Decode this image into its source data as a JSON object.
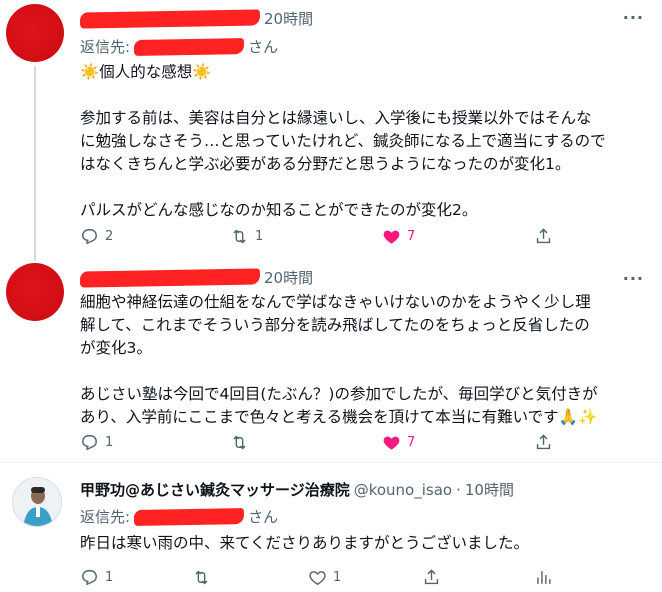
{
  "tweets": [
    {
      "time": "20時間",
      "reply_prefix": "返信先:",
      "reply_suffix": "さん",
      "lines": [
        "☀️個人的な感想☀️",
        "",
        "参加する前は、美容は自分とは縁遠いし、入学後にも授業以外ではそんな",
        "に勉強しなさそう…と思っていたけれど、鍼灸師になる上で適当にするので",
        "はなくきちんと学ぶ必要がある分野だと思うようになったのが変化1。",
        "",
        "パルスがどんな感じなのか知ることができたのが変化2。"
      ],
      "replies": "2",
      "retweets": "1",
      "likes": "7",
      "liked": true
    },
    {
      "time": "20時間",
      "lines": [
        "細胞や神経伝達の仕組をなんで学ばなきゃいけないのかをようやく少し理",
        "解して、これまでそういう部分を読み飛ばしてたのをちょっと反省したの",
        "が変化3。",
        "",
        "あじさい塾は今回で4回目(たぶん？)の参加でしたが、毎回学びと気付きが",
        "あり、入学前にここまで色々と考える機会を頂けて本当に有難いです🙏✨"
      ],
      "replies": "1",
      "retweets": "",
      "likes": "7",
      "liked": true
    },
    {
      "name": "甲野功@あじさい鍼灸マッサージ治療院",
      "handle": "@kouno_isao",
      "separator": "·",
      "time": "10時間",
      "reply_prefix": "返信先:",
      "reply_suffix": "さん",
      "lines": [
        "昨日は寒い雨の中、来てくださりありますがとうございました。"
      ],
      "replies": "1",
      "retweets": "",
      "likes": "1",
      "liked": false
    }
  ],
  "more_label": "···",
  "colors": {
    "accent_like": "#f91880",
    "muted": "#536471",
    "redaction": "#ff2222"
  }
}
